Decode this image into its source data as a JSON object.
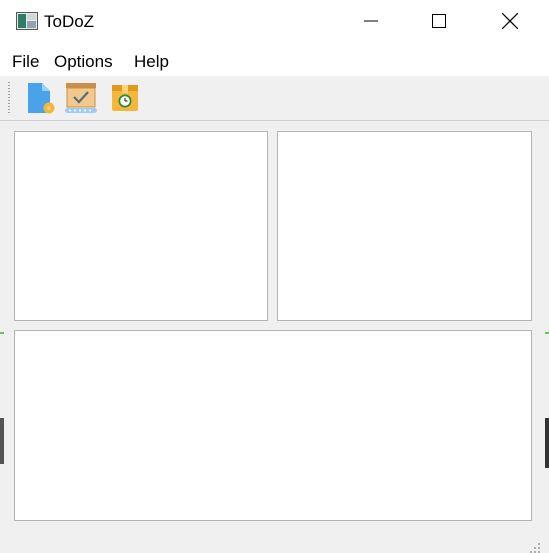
{
  "window": {
    "title": "ToDoZ"
  },
  "menu": {
    "items": [
      {
        "label": "File"
      },
      {
        "label": "Options"
      },
      {
        "label": "Help"
      }
    ]
  },
  "toolbar": {
    "buttons": [
      {
        "icon": "new-document-icon"
      },
      {
        "icon": "task-done-box-icon"
      },
      {
        "icon": "scheduled-box-icon"
      }
    ]
  },
  "colors": {
    "window_bg": "#f0f0f0",
    "panel_bg": "#ffffff",
    "panel_border": "#b4b4b4",
    "doc_icon_blue": "#4aa3e8",
    "box_icon_orange": "#f5b63a"
  }
}
